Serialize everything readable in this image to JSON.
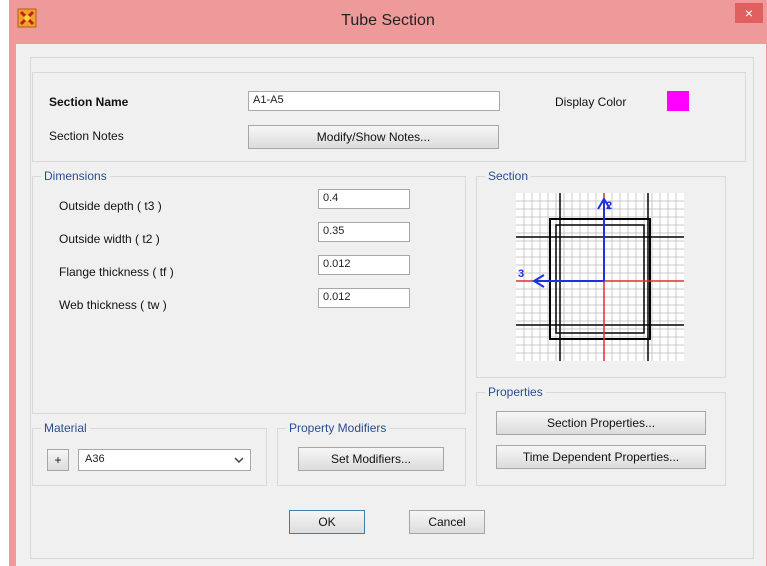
{
  "window": {
    "title": "Tube Section",
    "close_glyph": "×"
  },
  "header": {
    "section_name_label": "Section Name",
    "section_name_value": "A1-A5",
    "display_color_label": "Display Color",
    "display_color": "#ff00ff",
    "section_notes_label": "Section Notes",
    "notes_button": "Modify/Show Notes..."
  },
  "dimensions": {
    "title": "Dimensions",
    "rows": [
      {
        "label": "Outside depth  ( t3 )",
        "value": "0.4"
      },
      {
        "label": "Outside width  ( t2 )",
        "value": "0.35"
      },
      {
        "label": "Flange thickness  ( tf )",
        "value": "0.012"
      },
      {
        "label": "Web thickness  ( tw )",
        "value": "0.012"
      }
    ]
  },
  "section": {
    "title": "Section",
    "axis_vertical": "2",
    "axis_horizontal": "3"
  },
  "properties": {
    "title": "Properties",
    "section_properties_button": "Section Properties...",
    "time_dependent_button": "Time Dependent Properties..."
  },
  "material": {
    "title": "Material",
    "plus": "+",
    "value": "A36"
  },
  "modifiers": {
    "title": "Property Modifiers",
    "button": "Set Modifiers..."
  },
  "footer": {
    "ok": "OK",
    "cancel": "Cancel"
  }
}
